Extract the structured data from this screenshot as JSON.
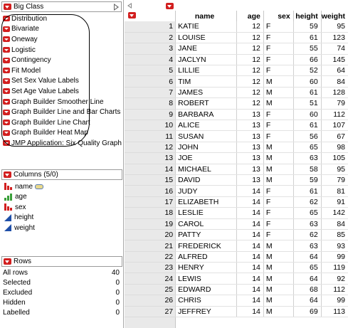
{
  "table_panel": {
    "title": "Big Class",
    "scripts": [
      "Distribution",
      "Bivariate",
      "Oneway",
      "Logistic",
      "Contingency",
      "Fit Model",
      "Set Sex Value Labels",
      "Set Age Value Labels",
      "Graph Builder Smoother Line",
      "Graph Builder Line and Bar Charts",
      "Graph Builder Line Chart",
      "Graph Builder Heat Map",
      "JMP Application: Six Quality Graph"
    ]
  },
  "columns_panel": {
    "title": "Columns (5/0)",
    "columns": [
      {
        "name": "name",
        "type": "nominal",
        "icon": "nominal-icon",
        "key": true
      },
      {
        "name": "age",
        "type": "ordinal",
        "icon": "ordinal-icon",
        "key": false
      },
      {
        "name": "sex",
        "type": "nominal",
        "icon": "nominal-icon",
        "key": false
      },
      {
        "name": "height",
        "type": "continuous",
        "icon": "continuous-icon",
        "key": false
      },
      {
        "name": "weight",
        "type": "continuous",
        "icon": "continuous-icon",
        "key": false
      }
    ]
  },
  "rows_panel": {
    "title": "Rows",
    "items": [
      {
        "label": "All rows",
        "value": "40"
      },
      {
        "label": "Selected",
        "value": "0"
      },
      {
        "label": "Excluded",
        "value": "0"
      },
      {
        "label": "Hidden",
        "value": "0"
      },
      {
        "label": "Labelled",
        "value": "0"
      }
    ]
  },
  "data_table": {
    "headers": [
      "name",
      "age",
      "sex",
      "height",
      "weight"
    ],
    "rows": [
      [
        "1",
        "KATIE",
        "12",
        "F",
        "59",
        "95"
      ],
      [
        "2",
        "LOUISE",
        "12",
        "F",
        "61",
        "123"
      ],
      [
        "3",
        "JANE",
        "12",
        "F",
        "55",
        "74"
      ],
      [
        "4",
        "JACLYN",
        "12",
        "F",
        "66",
        "145"
      ],
      [
        "5",
        "LILLIE",
        "12",
        "F",
        "52",
        "64"
      ],
      [
        "6",
        "TIM",
        "12",
        "M",
        "60",
        "84"
      ],
      [
        "7",
        "JAMES",
        "12",
        "M",
        "61",
        "128"
      ],
      [
        "8",
        "ROBERT",
        "12",
        "M",
        "51",
        "79"
      ],
      [
        "9",
        "BARBARA",
        "13",
        "F",
        "60",
        "112"
      ],
      [
        "10",
        "ALICE",
        "13",
        "F",
        "61",
        "107"
      ],
      [
        "11",
        "SUSAN",
        "13",
        "F",
        "56",
        "67"
      ],
      [
        "12",
        "JOHN",
        "13",
        "M",
        "65",
        "98"
      ],
      [
        "13",
        "JOE",
        "13",
        "M",
        "63",
        "105"
      ],
      [
        "14",
        "MICHAEL",
        "13",
        "M",
        "58",
        "95"
      ],
      [
        "15",
        "DAVID",
        "13",
        "M",
        "59",
        "79"
      ],
      [
        "16",
        "JUDY",
        "14",
        "F",
        "61",
        "81"
      ],
      [
        "17",
        "ELIZABETH",
        "14",
        "F",
        "62",
        "91"
      ],
      [
        "18",
        "LESLIE",
        "14",
        "F",
        "65",
        "142"
      ],
      [
        "19",
        "CAROL",
        "14",
        "F",
        "63",
        "84"
      ],
      [
        "20",
        "PATTY",
        "14",
        "F",
        "62",
        "85"
      ],
      [
        "21",
        "FREDERICK",
        "14",
        "M",
        "63",
        "93"
      ],
      [
        "22",
        "ALFRED",
        "14",
        "M",
        "64",
        "99"
      ],
      [
        "23",
        "HENRY",
        "14",
        "M",
        "65",
        "119"
      ],
      [
        "24",
        "LEWIS",
        "14",
        "M",
        "64",
        "92"
      ],
      [
        "25",
        "EDWARD",
        "14",
        "M",
        "68",
        "112"
      ],
      [
        "26",
        "CHRIS",
        "14",
        "M",
        "64",
        "99"
      ],
      [
        "27",
        "JEFFREY",
        "14",
        "M",
        "69",
        "113"
      ]
    ]
  },
  "colors": {
    "hotspot_red": "#d21f1f",
    "row_header_gray": "#e9e9e9",
    "continuous_blue": "#1f4fa8",
    "ordinal_green": "#3aa03a"
  }
}
